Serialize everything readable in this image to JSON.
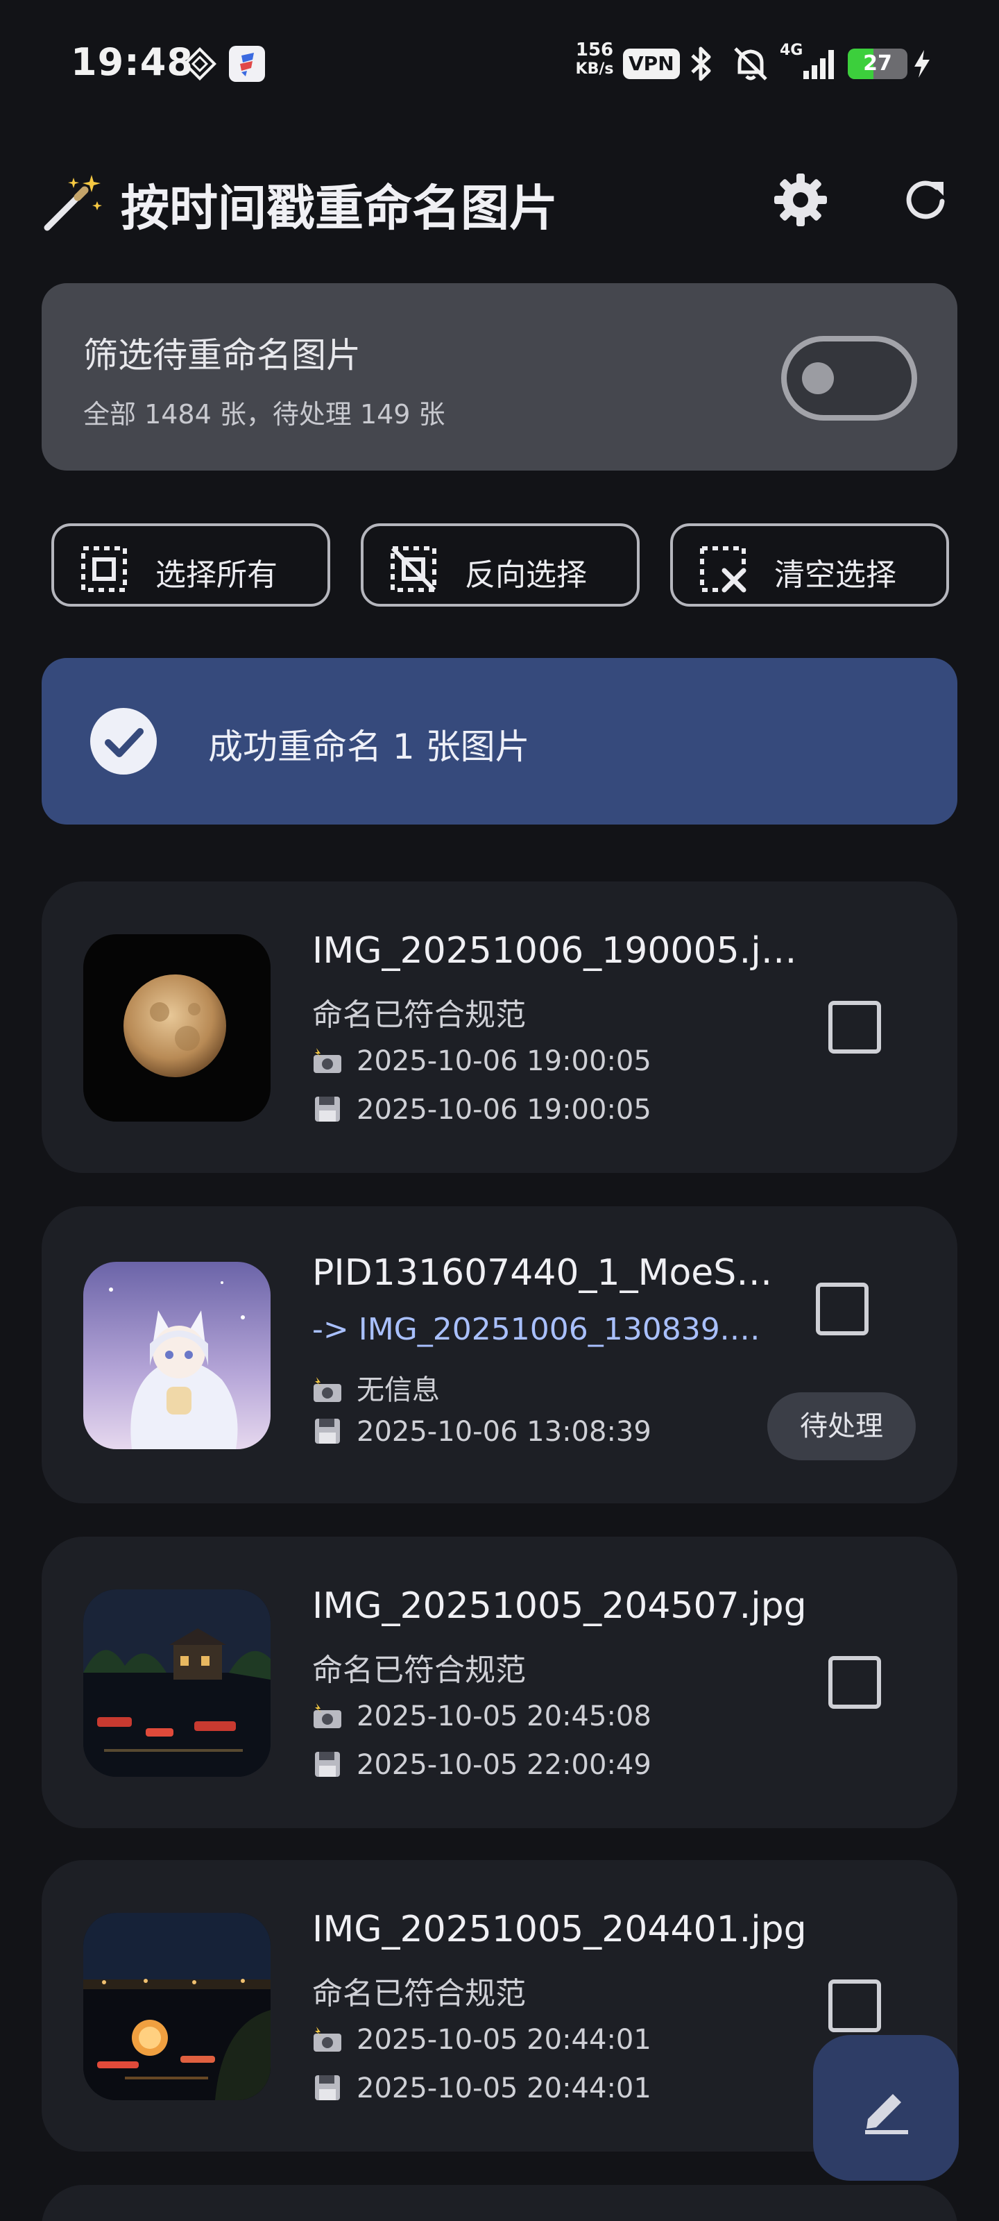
{
  "status_bar": {
    "time": "19:48",
    "net_speed_value": "156",
    "net_speed_unit": "KB/s",
    "vpn_label": "VPN",
    "network_type": "4G",
    "battery_level": "27",
    "battery_fraction": 0.27,
    "icons": [
      "location-diamond-icon",
      "app-notification-icon",
      "bluetooth-icon",
      "bell-muted-icon",
      "signal-icon",
      "battery-icon",
      "charging-icon"
    ]
  },
  "app_bar": {
    "title": "按时间戳重命名图片",
    "icons": [
      "magic-wand-icon",
      "gear-icon",
      "refresh-icon"
    ]
  },
  "filter": {
    "title": "筛选待重命名图片",
    "summary": "全部 1484 张，待处理 149 张",
    "enabled": false
  },
  "selection_buttons": [
    {
      "label": "选择所有",
      "icon": "select-all-icon"
    },
    {
      "label": "反向选择",
      "icon": "select-inverse-icon"
    },
    {
      "label": "清空选择",
      "icon": "clear-selection-icon"
    }
  ],
  "banner": {
    "message": "成功重命名 1 张图片",
    "icon": "check-circle-icon"
  },
  "images": [
    {
      "file_name": "IMG_20251006_190005.j…",
      "status": "命名已符合规范",
      "taken_time": "2025-10-06 19:00:05",
      "saved_time": "2025-10-06 19:00:05",
      "checked": false
    },
    {
      "file_name": "PID131607440_1_MoeS…",
      "status": "-> IMG_20251006_130839.…",
      "taken_time": "无信息",
      "saved_time": "2025-10-06 13:08:39",
      "checked": false,
      "badge": "待处理"
    },
    {
      "file_name": "IMG_20251005_204507.jpg",
      "status": "命名已符合规范",
      "taken_time": "2025-10-05 20:45:08",
      "saved_time": "2025-10-05 22:00:49",
      "checked": false
    },
    {
      "file_name": "IMG_20251005_204401.jpg",
      "status": "命名已符合规范",
      "taken_time": "2025-10-05 20:44:01",
      "saved_time": "2025-10-05 20:44:01",
      "checked": false
    }
  ],
  "meta_icons": {
    "taken": "camera-flash-icon",
    "saved": "floppy-disk-icon"
  },
  "fab": {
    "icon": "edit-pencil-icon"
  },
  "colors": {
    "background": "#121317",
    "filter_card": "#45474e",
    "banner": "#364a7c",
    "card": "#1d1f25",
    "pending_text": "#a9c0ff",
    "fab": "#2e3d66"
  }
}
